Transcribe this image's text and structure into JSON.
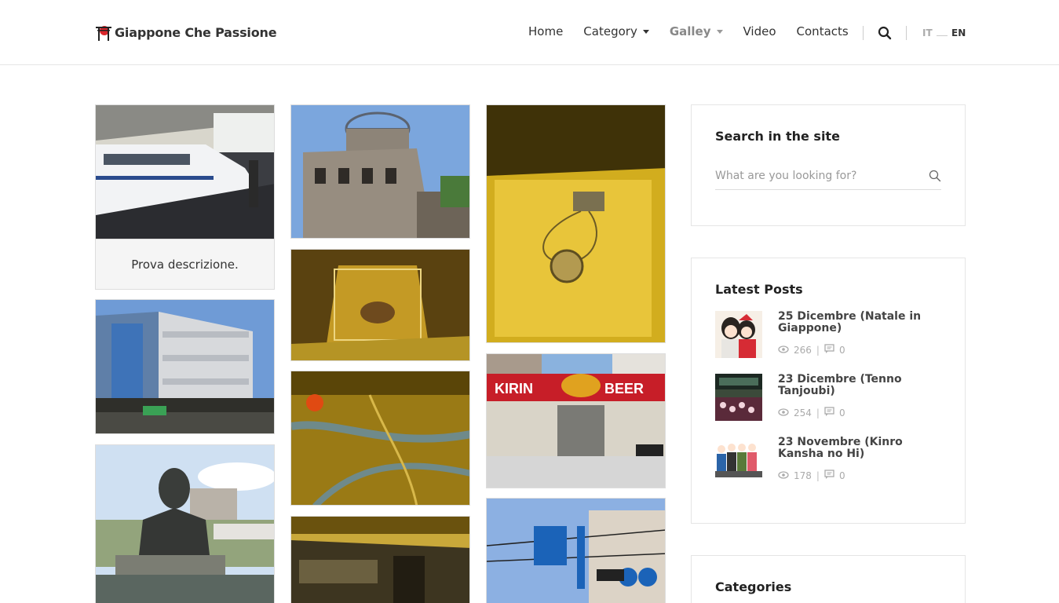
{
  "site": {
    "title": "Giappone Che Passione"
  },
  "nav": {
    "home": "Home",
    "category": "Category",
    "gallery": "Galley",
    "video": "Video",
    "contacts": "Contacts"
  },
  "lang": {
    "it": "IT",
    "en": "EN"
  },
  "gallery": {
    "caption": "Prova descrizione."
  },
  "sidebar": {
    "search": {
      "title": "Search in the site",
      "placeholder": "What are you looking for?"
    },
    "latest": {
      "title": "Latest Posts",
      "posts": [
        {
          "title": "25 Dicembre (Natale in Giappone)",
          "views": "266",
          "comments": "0"
        },
        {
          "title": "23 Dicembre (Tenno Tanjoubi)",
          "views": "254",
          "comments": "0"
        },
        {
          "title": "23 Novembre (Kinro Kansha no Hi)",
          "views": "178",
          "comments": "0"
        }
      ]
    },
    "categories": {
      "title": "Categories"
    }
  },
  "colors": {
    "accent": "#333333",
    "logo_red": "#d9262b"
  },
  "icons": {
    "search": "search-icon",
    "views": "eye-icon",
    "comments": "comment-icon"
  }
}
